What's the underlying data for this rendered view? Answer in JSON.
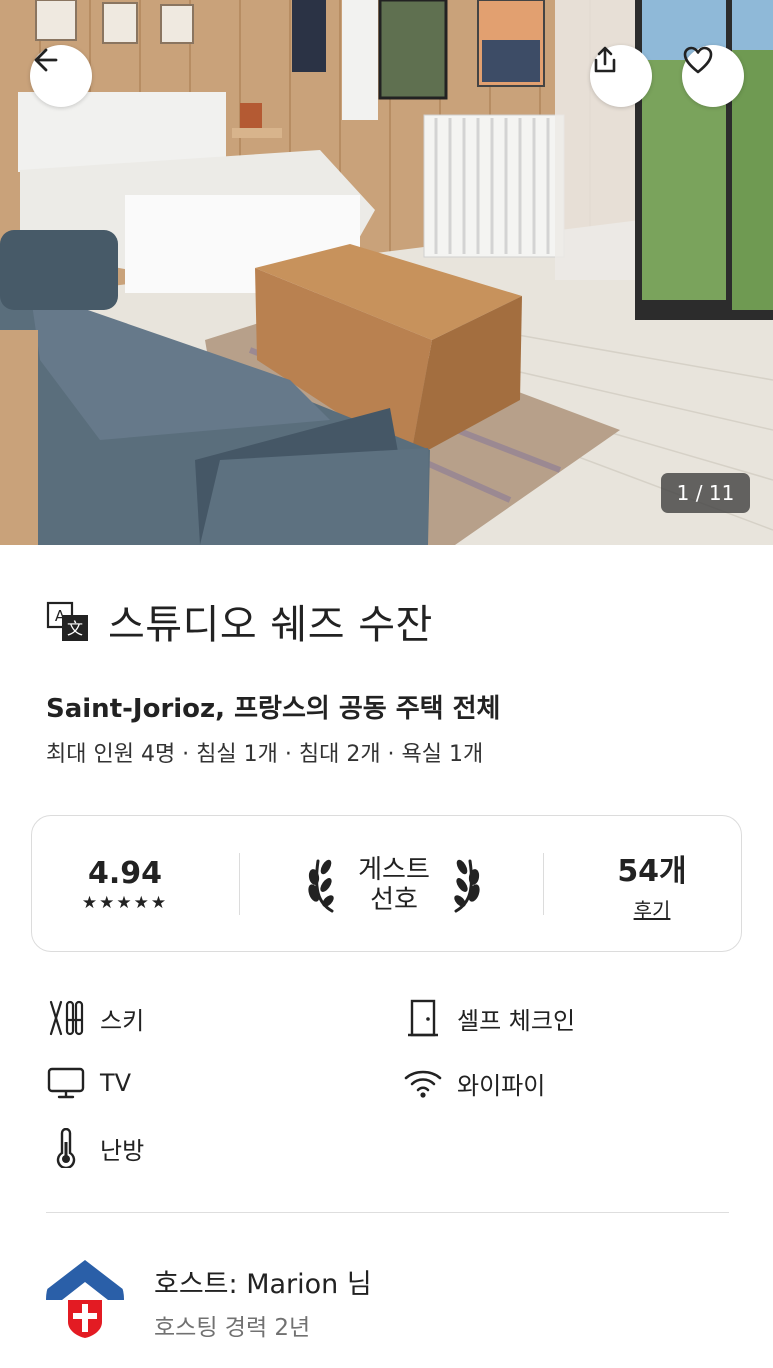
{
  "hero": {
    "photo_description_icon": "room-photo",
    "counter": "1 / 11",
    "back_icon": "arrow-left-icon",
    "share_icon": "share-icon",
    "favorite_icon": "heart-icon"
  },
  "listing": {
    "title": "스튜디오 쉐즈 수잔",
    "translate_icon": "translate-icon",
    "location": "Saint-Jorioz, 프랑스의 공동 주택 전체",
    "details": "최대 인원 4명 · 침실 1개 · 침대 2개 · 욕실 1개"
  },
  "rating": {
    "score": "4.94",
    "stars": "★★★★★",
    "guest_favorite_line1": "게스트",
    "guest_favorite_line2": "선호",
    "reviews_count": "54개",
    "reviews_label": "후기"
  },
  "amenities": [
    {
      "label": "스키",
      "icon": "ski-icon"
    },
    {
      "label": "셀프 체크인",
      "icon": "door-icon"
    },
    {
      "label": "TV",
      "icon": "tv-icon"
    },
    {
      "label": "와이파이",
      "icon": "wifi-icon"
    },
    {
      "label": "난방",
      "icon": "thermometer-icon"
    }
  ],
  "host": {
    "name": "호스트: Marion 님",
    "experience": "호스팅 경력 2년",
    "avatar_icon": "host-avatar"
  },
  "colors": {
    "text": "#222222",
    "muted": "#717171",
    "avatar_red": "#e31b23",
    "avatar_blue": "#2a5fa8"
  }
}
